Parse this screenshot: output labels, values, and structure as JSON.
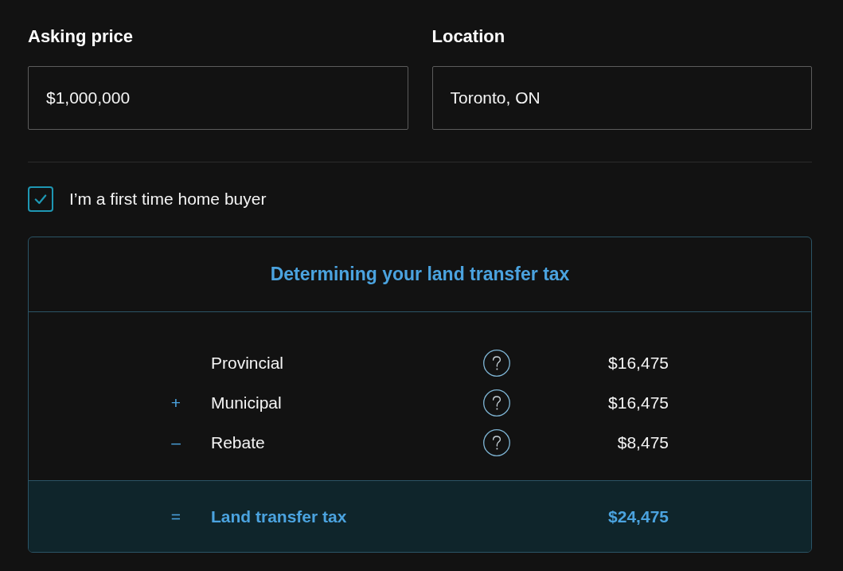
{
  "fields": [
    {
      "label": "Asking price",
      "value": "$1,000,000"
    },
    {
      "label": "Location",
      "value": "Toronto, ON"
    }
  ],
  "first_time_buyer": {
    "label": "I’m a first time home buyer",
    "checked": true
  },
  "breakdown": {
    "title": "Determining your land transfer tax",
    "rows": [
      {
        "label": "Provincial",
        "amount": "$16,475"
      },
      {
        "operator": "+",
        "label": "Municipal",
        "amount": "$16,475"
      },
      {
        "operator": "–",
        "label": "Rebate",
        "amount": "$8,475"
      }
    ],
    "total": {
      "operator": "=",
      "label": "Land transfer tax",
      "amount": "$24,475"
    }
  }
}
